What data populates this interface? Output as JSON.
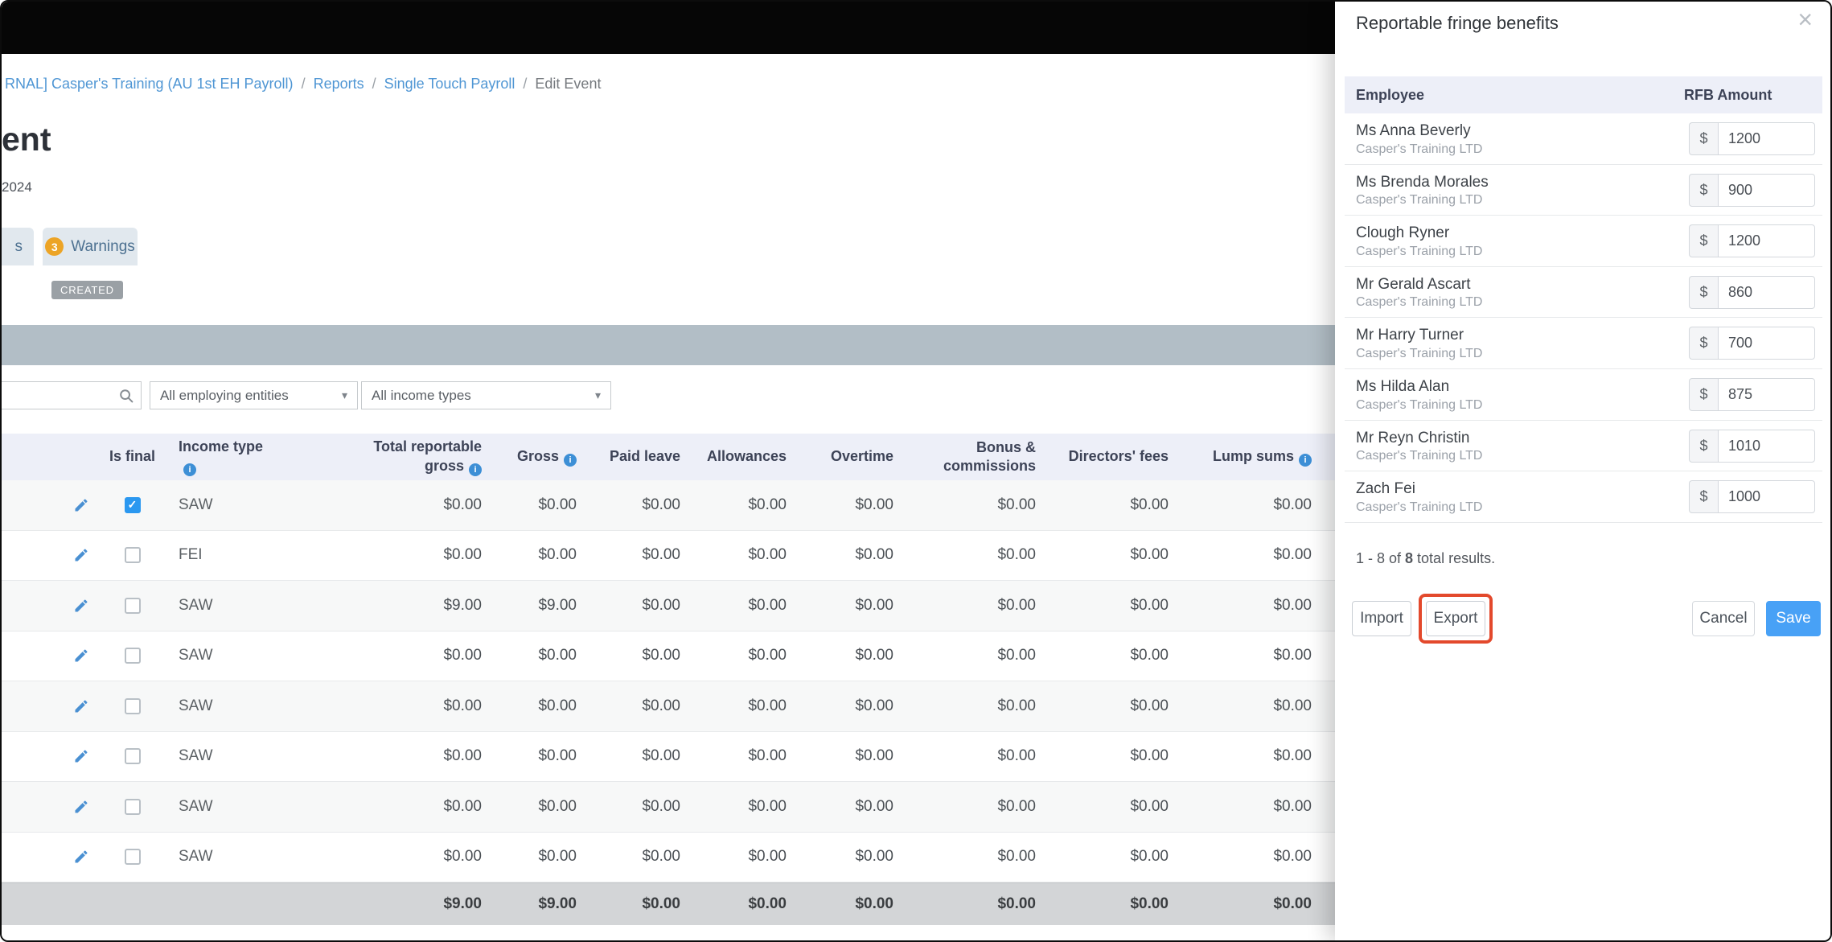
{
  "colors": {
    "link": "#4f96d4",
    "save_button": "#48a1f6",
    "export_highlight": "#e3492c",
    "warning_badge": "#eca426",
    "band": "#b2bec6",
    "table_header_bg": "#edeff8",
    "checkbox_checked": "#2b98f0",
    "info_icon": "#3d8fd6",
    "totals_row_bg": "#d3d5d7",
    "top_bar": "#060606"
  },
  "icons": {
    "info": "i",
    "check": "✓",
    "caret": "▾",
    "close": "×"
  },
  "breadcrumb": {
    "separator": "/",
    "items": [
      {
        "label": "RNAL] Casper's Training (AU 1st EH Payroll)",
        "current": false
      },
      {
        "label": "Reports",
        "current": false
      },
      {
        "label": "Single Touch Payroll",
        "current": false
      },
      {
        "label": "Edit Event",
        "current": true
      }
    ]
  },
  "page": {
    "title_fragment": "ent",
    "date_fragment": "2024",
    "status_badge": "CREATED"
  },
  "tabs": {
    "left_fragment": "s",
    "warnings": {
      "label": "Warnings",
      "count": "3"
    }
  },
  "filters": {
    "search_value": "",
    "entities_dropdown": "All employing entities",
    "income_dropdown": "All income types"
  },
  "table": {
    "columns": [
      {
        "id": "edit",
        "label": "",
        "align": "center"
      },
      {
        "id": "is-final",
        "label": "Is final",
        "align": "center"
      },
      {
        "id": "income-type",
        "label": "Income type",
        "info": true,
        "align": "left"
      },
      {
        "id": "total-reportable-gross",
        "lines": [
          "Total reportable",
          "gross"
        ],
        "info": true,
        "align": "right"
      },
      {
        "id": "gross",
        "label": "Gross",
        "info": true,
        "align": "right"
      },
      {
        "id": "paid-leave",
        "label": "Paid leave",
        "align": "right"
      },
      {
        "id": "allowances",
        "label": "Allowances",
        "align": "right"
      },
      {
        "id": "overtime",
        "label": "Overtime",
        "align": "right"
      },
      {
        "id": "bonus-commissions",
        "lines": [
          "Bonus &",
          "commissions"
        ],
        "align": "right"
      },
      {
        "id": "directors-fees",
        "label": "Directors' fees",
        "align": "right"
      },
      {
        "id": "lump-sums",
        "label": "Lump sums",
        "info": true,
        "align": "right"
      }
    ],
    "rows": [
      {
        "income_type": "SAW",
        "is_final": true,
        "values": [
          "$0.00",
          "$0.00",
          "$0.00",
          "$0.00",
          "$0.00",
          "$0.00",
          "$0.00",
          "$0.00"
        ]
      },
      {
        "income_type": "FEI",
        "is_final": false,
        "values": [
          "$0.00",
          "$0.00",
          "$0.00",
          "$0.00",
          "$0.00",
          "$0.00",
          "$0.00",
          "$0.00"
        ]
      },
      {
        "income_type": "SAW",
        "is_final": false,
        "values": [
          "$9.00",
          "$9.00",
          "$0.00",
          "$0.00",
          "$0.00",
          "$0.00",
          "$0.00",
          "$0.00"
        ]
      },
      {
        "income_type": "SAW",
        "is_final": false,
        "values": [
          "$0.00",
          "$0.00",
          "$0.00",
          "$0.00",
          "$0.00",
          "$0.00",
          "$0.00",
          "$0.00"
        ]
      },
      {
        "income_type": "SAW",
        "is_final": false,
        "values": [
          "$0.00",
          "$0.00",
          "$0.00",
          "$0.00",
          "$0.00",
          "$0.00",
          "$0.00",
          "$0.00"
        ]
      },
      {
        "income_type": "SAW",
        "is_final": false,
        "values": [
          "$0.00",
          "$0.00",
          "$0.00",
          "$0.00",
          "$0.00",
          "$0.00",
          "$0.00",
          "$0.00"
        ]
      },
      {
        "income_type": "SAW",
        "is_final": false,
        "values": [
          "$0.00",
          "$0.00",
          "$0.00",
          "$0.00",
          "$0.00",
          "$0.00",
          "$0.00",
          "$0.00"
        ]
      },
      {
        "income_type": "SAW",
        "is_final": false,
        "values": [
          "$0.00",
          "$0.00",
          "$0.00",
          "$0.00",
          "$0.00",
          "$0.00",
          "$0.00",
          "$0.00"
        ]
      }
    ],
    "totals": [
      "$9.00",
      "$9.00",
      "$0.00",
      "$0.00",
      "$0.00",
      "$0.00",
      "$0.00",
      "$0.00"
    ]
  },
  "panel": {
    "title": "Reportable fringe benefits",
    "columns": {
      "employee": "Employee",
      "amount": "RFB Amount"
    },
    "company": "Casper's Training LTD",
    "currency": "$",
    "rows": [
      {
        "name": "Ms Anna Beverly",
        "amount": "1200"
      },
      {
        "name": "Ms Brenda Morales",
        "amount": "900"
      },
      {
        "name": "Clough Ryner",
        "amount": "1200"
      },
      {
        "name": "Mr Gerald Ascart",
        "amount": "860"
      },
      {
        "name": "Mr Harry Turner",
        "amount": "700"
      },
      {
        "name": "Ms Hilda Alan",
        "amount": "875"
      },
      {
        "name": "Mr Reyn Christin",
        "amount": "1010"
      },
      {
        "name": "Zach Fei",
        "amount": "1000"
      }
    ],
    "results": {
      "prefix": "1 - 8 of ",
      "count": "8",
      "suffix": " total results."
    },
    "buttons": {
      "import": "Import",
      "export": "Export",
      "cancel": "Cancel",
      "save": "Save"
    }
  }
}
